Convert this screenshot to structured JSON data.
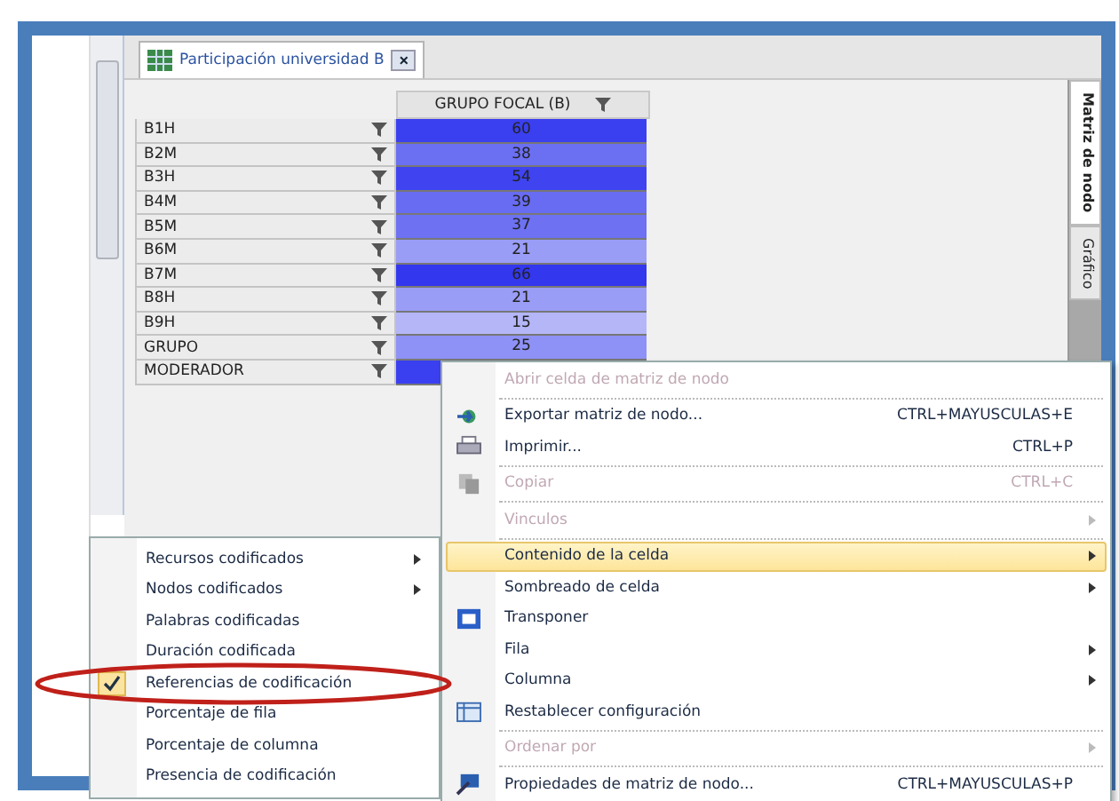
{
  "tab": {
    "title": "Participación universidad B",
    "close": "×"
  },
  "side_tabs": [
    {
      "label": "Matriz de nodo",
      "selected": true
    },
    {
      "label": "Gráfico",
      "selected": false
    }
  ],
  "matrix": {
    "column": "GRUPO FOCAL (B)",
    "rows": [
      {
        "label": "B1H",
        "value": "60",
        "color": "#3a3ff0"
      },
      {
        "label": "B2M",
        "value": "38",
        "color": "#6b6ff2"
      },
      {
        "label": "B3H",
        "value": "54",
        "color": "#3f44f0"
      },
      {
        "label": "B4M",
        "value": "39",
        "color": "#686cf2"
      },
      {
        "label": "B5M",
        "value": "37",
        "color": "#6d71f2"
      },
      {
        "label": "B6M",
        "value": "21",
        "color": "#9a9df6"
      },
      {
        "label": "B7M",
        "value": "66",
        "color": "#3337ee"
      },
      {
        "label": "B8H",
        "value": "21",
        "color": "#9a9df6"
      },
      {
        "label": "B9H",
        "value": "15",
        "color": "#b4b6f8"
      },
      {
        "label": "GRUPO",
        "value": "25",
        "color": "#8e91f5"
      },
      {
        "label": "MODERADOR",
        "value": "",
        "color": "#3a3ff0"
      }
    ]
  },
  "context_menu": {
    "groups": [
      [
        {
          "label": "Abrir celda de matriz de nodo",
          "disabled": true,
          "selected": false,
          "submenu": false
        }
      ],
      [
        {
          "label": "Exportar matriz de nodo...",
          "shortcut": "CTRL+MAYUSCULAS+E",
          "kind": "export",
          "disabled": false,
          "selected": false,
          "submenu": false
        },
        {
          "label": "Imprimir...",
          "shortcut": "CTRL+P",
          "kind": "print",
          "disabled": false,
          "selected": false,
          "submenu": false
        }
      ],
      [
        {
          "label": "Copiar",
          "shortcut": "CTRL+C",
          "kind": "copy",
          "disabled": true,
          "selected": false,
          "submenu": false
        }
      ],
      [
        {
          "label": "Vinculos",
          "disabled": true,
          "selected": false,
          "submenu": true
        }
      ],
      [
        {
          "label": "Contenido de la celda",
          "disabled": false,
          "selected": true,
          "submenu": true
        },
        {
          "label": "Sombreado de celda",
          "disabled": false,
          "selected": false,
          "submenu": true
        },
        {
          "label": "Transponer",
          "kind": "transpose",
          "disabled": false,
          "selected": false,
          "submenu": false
        },
        {
          "label": "Fila",
          "disabled": false,
          "selected": false,
          "submenu": true
        },
        {
          "label": "Columna",
          "disabled": false,
          "selected": false,
          "submenu": true
        },
        {
          "label": "Restablecer configuración",
          "kind": "reset",
          "disabled": false,
          "selected": false,
          "submenu": false
        }
      ],
      [
        {
          "label": "Ordenar por",
          "disabled": true,
          "selected": false,
          "submenu": true
        }
      ],
      [
        {
          "label": "Propiedades de matriz de nodo...",
          "shortcut": "CTRL+MAYUSCULAS+P",
          "kind": "properties",
          "disabled": false,
          "selected": false,
          "submenu": false
        }
      ]
    ]
  },
  "cell_submenu": [
    {
      "label": "Recursos codificados",
      "submenu": true,
      "checked": false,
      "circled": false
    },
    {
      "label": "Nodos codificados",
      "submenu": true,
      "checked": false,
      "circled": false
    },
    {
      "label": "Palabras codificadas",
      "submenu": false,
      "checked": false,
      "circled": false
    },
    {
      "label": "Duración codificada",
      "submenu": false,
      "checked": false,
      "circled": false
    },
    {
      "label": "Referencias de codificación",
      "submenu": false,
      "checked": true,
      "circled": true
    },
    {
      "label": "Porcentaje de fila",
      "submenu": false,
      "checked": false,
      "circled": false
    },
    {
      "label": "Porcentaje de columna",
      "submenu": false,
      "checked": false,
      "circled": false
    },
    {
      "label": "Presencia de codificación",
      "submenu": false,
      "checked": false,
      "circled": false
    }
  ]
}
